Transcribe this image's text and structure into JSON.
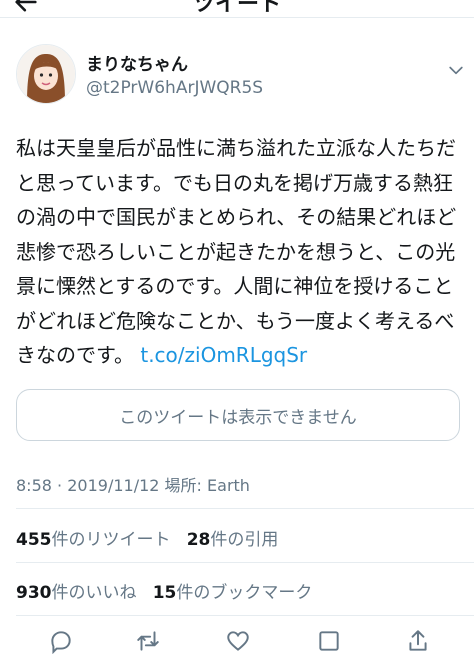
{
  "header": {
    "title": "ツイート"
  },
  "author": {
    "name": "まりなちゃん",
    "handle": "@t2PrW6hArJWQR5S"
  },
  "tweet": {
    "text": "私は天皇皇后が品性に満ち溢れた立派な人たちだと思っています。でも日の丸を掲げ万歳する熱狂の渦の中で国民がまとめられ、その結果どれほど悲惨で恐ろしいことが起きたかを想うと、この光景に慄然とするのです。人間に神位を授けることがどれほど危険なことか、もう一度よく考えるべきなのです。 ",
    "link": "t.co/ziOmRLgqSr"
  },
  "quote": {
    "unavailable_text": "このツイートは表示できません"
  },
  "meta": {
    "time": "8:58",
    "separator": "·",
    "date": "2019/11/12",
    "place_label": "場所:",
    "place": "Earth"
  },
  "stats": {
    "retweets": {
      "count": "455",
      "label": "件のリツイート"
    },
    "quotes": {
      "count": "28",
      "label": "件の引用"
    },
    "likes": {
      "count": "930",
      "label": "件のいいね"
    },
    "bookmarks": {
      "count": "15",
      "label": "件のブックマーク"
    }
  },
  "icons": [
    "back-arrow-icon",
    "chevron-down-icon",
    "reply-icon",
    "retweet-icon",
    "like-icon",
    "bookmark-icon",
    "share-icon"
  ],
  "colors": {
    "link": "#1b95e0",
    "secondary_text": "#657786",
    "border": "#ccd6dd"
  }
}
